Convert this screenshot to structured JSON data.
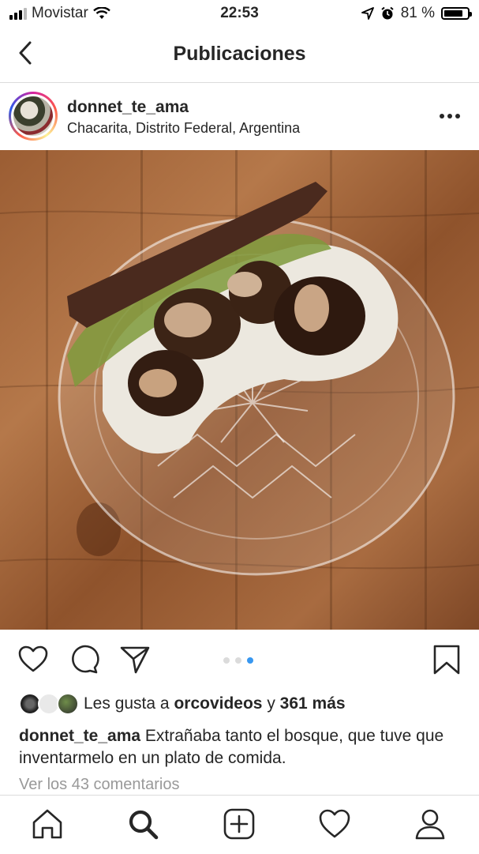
{
  "status_bar": {
    "carrier": "Movistar",
    "time": "22:53",
    "battery_percent": "81 %",
    "battery_level": 0.81,
    "icons": [
      "signal-bars-icon",
      "wifi-icon",
      "location-arrow-icon",
      "alarm-icon",
      "battery-icon"
    ]
  },
  "header": {
    "title": "Publicaciones",
    "back_icon": "chevron-left-icon"
  },
  "post": {
    "username": "donnet_te_ama",
    "location": "Chacarita, Distrito Federal, Argentina",
    "more_icon": "ellipsis-icon",
    "carousel": {
      "count": 3,
      "active_index": 2
    },
    "likes": {
      "prefix": "Les gusta a",
      "liker": "orcovideos",
      "joiner": "y",
      "others": "361 más"
    },
    "caption": {
      "username": "donnet_te_ama",
      "text": "Extrañaba tanto el bosque, que tuve que inventarmelo en un plato de comida."
    },
    "comments_link": "Ver los 43 comentarios"
  },
  "actions": [
    "heart-icon",
    "comment-icon",
    "share-icon",
    "bookmark-icon"
  ],
  "tab_bar": [
    "home-icon",
    "search-icon",
    "add-post-icon",
    "activity-heart-icon",
    "profile-icon"
  ],
  "colors": {
    "accent": "#3897f0",
    "text": "#262626",
    "muted": "#999999",
    "divider": "#dbdbdb"
  }
}
